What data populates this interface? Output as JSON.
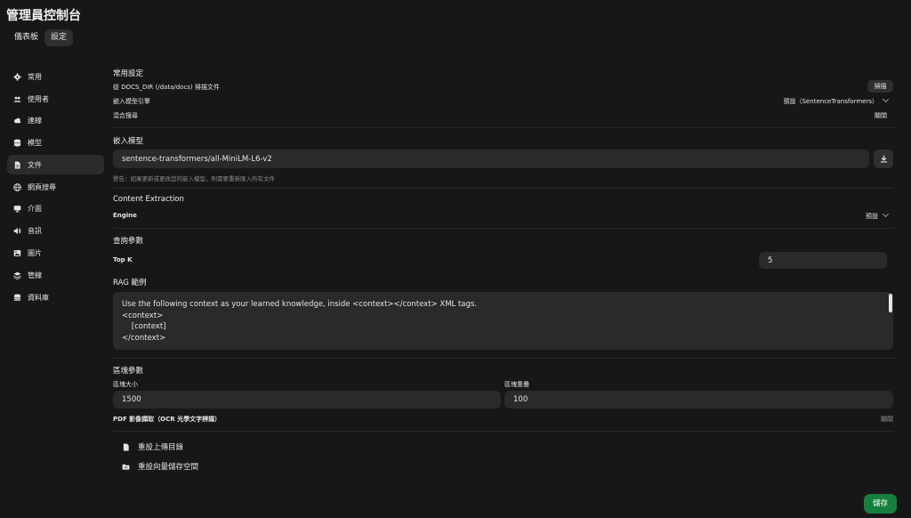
{
  "app": {
    "title": "管理員控制台"
  },
  "tabs": [
    {
      "label": "儀表板"
    },
    {
      "label": "設定"
    }
  ],
  "sidebar": {
    "items": [
      {
        "label": "常用",
        "icon": "gear-icon"
      },
      {
        "label": "使用者",
        "icon": "users-icon"
      },
      {
        "label": "連線",
        "icon": "cloud-icon"
      },
      {
        "label": "模型",
        "icon": "layers-icon"
      },
      {
        "label": "文件",
        "icon": "document-icon"
      },
      {
        "label": "網頁搜尋",
        "icon": "globe-icon"
      },
      {
        "label": "介面",
        "icon": "monitor-icon"
      },
      {
        "label": "音訊",
        "icon": "speaker-icon"
      },
      {
        "label": "圖片",
        "icon": "image-icon"
      },
      {
        "label": "管線",
        "icon": "stack-icon"
      },
      {
        "label": "資料庫",
        "icon": "database-icon"
      }
    ]
  },
  "general": {
    "heading": "常用設定",
    "scan_label": "從 DOCS_DIR (/data/docs) 掃描文件",
    "scan_button": "掃描",
    "embed_engine_label": "嵌入模型引擎",
    "embed_engine_value": "預設（SentenceTransformers）",
    "hybrid_label": "混合搜尋",
    "hybrid_value": "關閉"
  },
  "embedding": {
    "heading": "嵌入模型",
    "model_value": "sentence-transformers/all-MiniLM-L6-v2",
    "warning": "警告：如果更新或更改您的嵌入模型，則需要重新匯入所有文件"
  },
  "extraction": {
    "heading": "Content Extraction",
    "engine_label": "Engine",
    "engine_value": "預設"
  },
  "query": {
    "heading": "查詢參數",
    "topk_label": "Top K",
    "topk_value": "5"
  },
  "rag": {
    "heading": "RAG 範例",
    "template": "Use the following context as your learned knowledge, inside <context></context> XML tags.\n<context>\n    [context]\n</context>"
  },
  "chunk": {
    "heading": "區塊參數",
    "size_label": "區塊大小",
    "size_value": "1500",
    "overlap_label": "區塊重疊",
    "overlap_value": "100",
    "pdf_label": "PDF 影像擷取（OCR 光學文字辨識）",
    "pdf_value": "關閉"
  },
  "actions": {
    "reset_upload": "重設上傳目錄",
    "reset_vector": "重設向量儲存空間"
  },
  "footer": {
    "save": "儲存"
  }
}
